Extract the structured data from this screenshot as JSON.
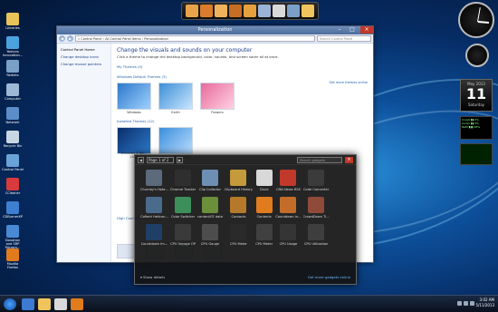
{
  "desktop_icons": [
    {
      "label": "Libraries",
      "color": "#e8c35a"
    },
    {
      "label": "Yeolons Innovation...",
      "color": "#4aa3df"
    },
    {
      "label": "Rediets",
      "color": "#7aa0c8"
    },
    {
      "label": "Computer",
      "color": "#9db8d6"
    },
    {
      "label": "Network",
      "color": "#5b8dc9"
    },
    {
      "label": "Recycle Bin",
      "color": "#c9d6e3"
    },
    {
      "label": "Control Panel",
      "color": "#6aa3d8"
    },
    {
      "label": "CCleaner",
      "color": "#d83b3b"
    },
    {
      "label": "CDBurnerXP",
      "color": "#3f7fd1"
    },
    {
      "label": "Donation and SRP Microm...",
      "color": "#4a8ad4"
    },
    {
      "label": "Mozilla Firefox",
      "color": "#e07b1e"
    }
  ],
  "dock_colors": [
    "#e8a44a",
    "#d97c2b",
    "#f0b35c",
    "#c76d24",
    "#e6a03d",
    "#9bb3d6",
    "#d9d9d9",
    "#7aa0c8",
    "#f0c45c"
  ],
  "gadgets": {
    "calendar": {
      "month": "May 2013",
      "day": "11",
      "weekday": "Saturday"
    },
    "meters": [
      "Core0 ▮▮ 0%",
      "Core1 ▮▮ 0%",
      "RAM ▮▮▮ 28%"
    ]
  },
  "window": {
    "title": "Personalization",
    "address": "« Control Panel  ›  All Control Panel Items  ›  Personalization",
    "search_placeholder": "Search Control Panel",
    "left_links": [
      "Control Panel Home",
      "Change desktop icons",
      "Change mouse pointers"
    ],
    "heading": "Change the visuals and sounds on your computer",
    "subheading": "Click a theme to change the desktop background, color, sounds, and screen saver all at once.",
    "my_themes_label": "My Themes (0)",
    "default_themes_label": "Windows Default Themes (3)",
    "get_online": "Get more themes online",
    "default_themes": [
      {
        "name": "Windows",
        "c1": "#2c79c9",
        "c2": "#9fd0ff"
      },
      {
        "name": "Earth",
        "c1": "#3d8fd6",
        "c2": "#c8e5ff"
      },
      {
        "name": "Flowers",
        "c1": "#e86a9b",
        "c2": "#ffd1e3"
      }
    ],
    "installed_label": "Installed Themes (12)",
    "installed_themes": [
      {
        "name": "Windows 8 Rel... 2014",
        "c1": "#0a2e6b",
        "c2": "#2c79c9"
      },
      {
        "name": "Aero 7 Squared (2)",
        "c1": "#3a8edb",
        "c2": "#b9dcff"
      }
    ],
    "high_contrast": "High Contrast Themes (4)"
  },
  "gadgets_dialog": {
    "page": "Page 1 of 2",
    "search_placeholder": "Search gadgets",
    "show_details": "Show details",
    "more_online": "Get more gadgets online",
    "items": [
      {
        "label": "Chumby's Hote...",
        "color": "#5b6b7c"
      },
      {
        "label": "Chrome Tracker",
        "color": "#2f2f2f"
      },
      {
        "label": "Clip Collector",
        "color": "#6d8fb3"
      },
      {
        "label": "Clipboard History",
        "color": "#c49a3a"
      },
      {
        "label": "Clock",
        "color": "#d8d8d8"
      },
      {
        "label": "CNN News RSS",
        "color": "#c0392b"
      },
      {
        "label": "Code Converter",
        "color": "#3b3b3b"
      },
      {
        "label": "",
        "color": "transparent"
      },
      {
        "label": "Cofiant Helicon...",
        "color": "#4a6b8c"
      },
      {
        "label": "Color Switcher",
        "color": "#3c8f5a"
      },
      {
        "label": "contentCE data",
        "color": "#6b8f3a"
      },
      {
        "label": "Contacts",
        "color": "#b5792b"
      },
      {
        "label": "Contents",
        "color": "#e07b1e"
      },
      {
        "label": "Countdown in...",
        "color": "#c46d2b"
      },
      {
        "label": "CrowdDown Ti...",
        "color": "#8f4a3a"
      },
      {
        "label": "",
        "color": "transparent"
      },
      {
        "label": "Countdown Im...",
        "color": "#1f3f66"
      },
      {
        "label": "CPU Voyage OP",
        "color": "#3a3a3a"
      },
      {
        "label": "CPU Gauge",
        "color": "#4d4d4d"
      },
      {
        "label": "CPU Meter",
        "color": "#2a2a2a"
      },
      {
        "label": "CPU Meter",
        "color": "#404040"
      },
      {
        "label": "CPU Usage",
        "color": "#353535"
      },
      {
        "label": "CPU Utilization",
        "color": "#3e3e3e"
      },
      {
        "label": "",
        "color": "transparent"
      }
    ]
  },
  "taskbar": {
    "item_colors": [
      "#3d7ad1",
      "#f0c45c",
      "#d9d9d9",
      "#e07b1e"
    ],
    "time": "3:02 AM",
    "date": "5/11/2013"
  }
}
